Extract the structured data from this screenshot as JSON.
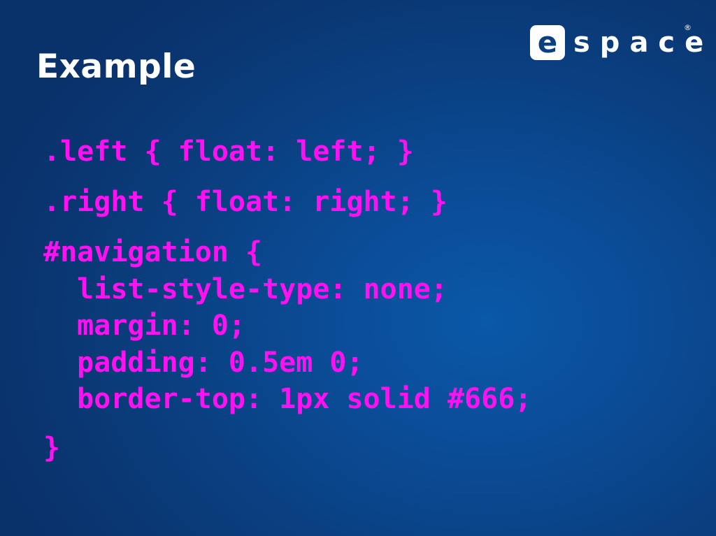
{
  "slide": {
    "title": "Example"
  },
  "logo": {
    "badge_letter": "e",
    "rest": "space",
    "registered_mark": "®"
  },
  "code": {
    "lines": [
      ".left { float: left; }",
      ".right { float: right; }",
      "#navigation {",
      "  list-style-type: none;",
      "  margin: 0;",
      "  padding: 0.5em 0;",
      "  border-top: 1px solid #666;",
      "}"
    ]
  },
  "colors": {
    "background": "#0b4c97",
    "title": "#ffffff",
    "code": "#ff11f2"
  }
}
